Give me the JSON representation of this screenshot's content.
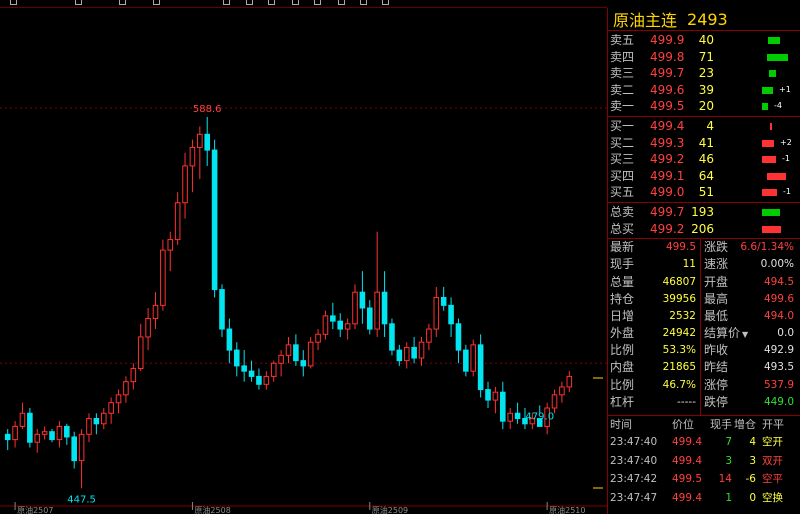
{
  "colors": {
    "up": "#ff3030",
    "down": "#00e5f0",
    "ask_bar": "#00cc00",
    "bid_bar": "#ff3333",
    "grid": "#800000",
    "label_red": "#ff4040"
  },
  "instrument": {
    "name": "原油主连",
    "code": "2493"
  },
  "asks": [
    {
      "label": "卖五",
      "price": "499.9",
      "vol": "40",
      "bar": 0.2,
      "chg": ""
    },
    {
      "label": "卖四",
      "price": "499.8",
      "vol": "71",
      "bar": 0.35,
      "chg": ""
    },
    {
      "label": "卖三",
      "price": "499.7",
      "vol": "23",
      "bar": 0.12,
      "chg": ""
    },
    {
      "label": "卖二",
      "price": "499.6",
      "vol": "39",
      "bar": 0.19,
      "chg": "+1"
    },
    {
      "label": "卖一",
      "price": "499.5",
      "vol": "20",
      "bar": 0.1,
      "chg": "-4"
    }
  ],
  "bids": [
    {
      "label": "买一",
      "price": "499.4",
      "vol": "4",
      "bar": 0.02,
      "chg": ""
    },
    {
      "label": "买二",
      "price": "499.3",
      "vol": "41",
      "bar": 0.2,
      "chg": "+2"
    },
    {
      "label": "买三",
      "price": "499.2",
      "vol": "46",
      "bar": 0.23,
      "chg": "-1"
    },
    {
      "label": "买四",
      "price": "499.1",
      "vol": "64",
      "bar": 0.32,
      "chg": ""
    },
    {
      "label": "买五",
      "price": "499.0",
      "vol": "51",
      "bar": 0.25,
      "chg": "-1"
    }
  ],
  "totals": [
    {
      "label": "总卖",
      "price": "499.7",
      "vol": "193",
      "bar": 0.3,
      "color": "ask"
    },
    {
      "label": "总买",
      "price": "499.2",
      "vol": "206",
      "bar": 0.32,
      "color": "bid"
    }
  ],
  "stats": [
    {
      "l1": "最新",
      "v1": "499.5",
      "c1": "cred",
      "l2": "涨跌",
      "v2": "6.6/1.34%",
      "c2": "cred"
    },
    {
      "l1": "现手",
      "v1": "11",
      "c1": "cyel",
      "l2": "速涨",
      "v2": "0.00%",
      "c2": "cwht"
    },
    {
      "l1": "总量",
      "v1": "46807",
      "c1": "cyel",
      "l2": "开盘",
      "v2": "494.5",
      "c2": "cred"
    },
    {
      "l1": "持仓",
      "v1": "39956",
      "c1": "cyel",
      "l2": "最高",
      "v2": "499.6",
      "c2": "cred"
    },
    {
      "l1": "日增",
      "v1": "2532",
      "c1": "cyel",
      "l2": "最低",
      "v2": "494.0",
      "c2": "cred"
    },
    {
      "l1": "外盘",
      "v1": "24942",
      "c1": "cyel",
      "l2": "结算价",
      "v2": "0.0",
      "c2": "cwht"
    },
    {
      "l1": "比例",
      "v1": "53.3%",
      "c1": "cyel",
      "l2": "昨收",
      "v2": "492.9",
      "c2": "cwht"
    },
    {
      "l1": "内盘",
      "v1": "21865",
      "c1": "cyel",
      "l2": "昨结",
      "v2": "493.5",
      "c2": "cwht"
    },
    {
      "l1": "比例",
      "v1": "46.7%",
      "c1": "cyel",
      "l2": "涨停",
      "v2": "537.9",
      "c2": "cred"
    },
    {
      "l1": "杠杆",
      "v1": "-----",
      "c1": "cwht",
      "l2": "跌停",
      "v2": "449.0",
      "c2": "cgrn"
    }
  ],
  "ticks_header": {
    "time": "时间",
    "price": "价位",
    "hand": "现手",
    "open": "增仓",
    "type": "开平"
  },
  "ticks": [
    {
      "time": "23:47:40",
      "price": "499.4",
      "hand": "7",
      "hc": "cgrn",
      "open": "4",
      "oc": "cyel",
      "type": "空开",
      "tc": "cyel"
    },
    {
      "time": "23:47:40",
      "price": "499.4",
      "hand": "3",
      "hc": "cgrn",
      "open": "3",
      "oc": "cyel",
      "type": "双开",
      "tc": "cred"
    },
    {
      "time": "23:47:42",
      "price": "499.5",
      "hand": "14",
      "hc": "cred",
      "open": "-6",
      "oc": "cyel",
      "type": "空平",
      "tc": "cred"
    },
    {
      "time": "23:47:47",
      "price": "499.4",
      "hand": "1",
      "hc": "cgrn",
      "open": "0",
      "oc": "cyel",
      "type": "空换",
      "tc": "cyel"
    }
  ],
  "chart_data": {
    "type": "candlestick",
    "ylim": [
      440,
      630
    ],
    "ref_lines": [
      592,
      495
    ],
    "x_labels": [
      {
        "i": 1,
        "text": "原油2507"
      },
      {
        "i": 25,
        "text": "原油2508"
      },
      {
        "i": 49,
        "text": "原油2509"
      },
      {
        "i": 73,
        "text": "原油2510"
      }
    ],
    "annotations": [
      {
        "i": 27,
        "price": 588.6,
        "text": "588.6",
        "pos": "above"
      },
      {
        "i": 10,
        "price": 447.5,
        "text": "447.5",
        "pos": "below"
      },
      {
        "i": 72,
        "price": 479.0,
        "text": "479.0",
        "pos": "below"
      }
    ],
    "candles": [
      [
        468,
        470,
        462,
        466
      ],
      [
        466,
        473,
        463,
        471
      ],
      [
        471,
        480,
        470,
        476
      ],
      [
        476,
        478,
        463,
        465
      ],
      [
        465,
        470,
        461,
        468
      ],
      [
        468,
        471,
        466,
        469
      ],
      [
        469,
        470,
        465,
        466
      ],
      [
        466,
        473,
        463,
        471
      ],
      [
        471,
        472,
        464,
        467
      ],
      [
        467,
        469,
        455,
        458
      ],
      [
        458,
        470,
        447.5,
        468
      ],
      [
        468,
        476,
        465,
        474
      ],
      [
        474,
        476,
        468,
        472
      ],
      [
        472,
        478,
        470,
        476
      ],
      [
        476,
        482,
        472,
        480
      ],
      [
        480,
        485,
        476,
        483
      ],
      [
        483,
        490,
        480,
        488
      ],
      [
        488,
        495,
        485,
        493
      ],
      [
        493,
        510,
        492,
        505
      ],
      [
        505,
        516,
        500,
        512
      ],
      [
        512,
        522,
        508,
        517
      ],
      [
        517,
        542,
        515,
        538
      ],
      [
        538,
        545,
        530,
        542
      ],
      [
        542,
        560,
        540,
        556
      ],
      [
        556,
        575,
        550,
        570
      ],
      [
        570,
        580,
        560,
        577
      ],
      [
        577,
        585,
        565,
        582
      ],
      [
        582,
        588.6,
        570,
        576
      ],
      [
        576,
        580,
        520,
        523
      ],
      [
        523,
        525,
        505,
        508
      ],
      [
        508,
        512,
        495,
        500
      ],
      [
        500,
        503,
        490,
        494
      ],
      [
        494,
        500,
        488,
        492
      ],
      [
        492,
        496,
        488,
        490
      ],
      [
        490,
        493,
        485,
        487
      ],
      [
        487,
        492,
        485,
        490
      ],
      [
        490,
        496,
        488,
        495
      ],
      [
        495,
        500,
        490,
        498
      ],
      [
        498,
        505,
        495,
        502
      ],
      [
        502,
        506,
        494,
        496
      ],
      [
        496,
        500,
        490,
        494
      ],
      [
        494,
        505,
        493,
        503
      ],
      [
        503,
        508,
        500,
        506
      ],
      [
        506,
        515,
        504,
        513
      ],
      [
        513,
        518,
        508,
        511
      ],
      [
        511,
        514,
        505,
        508
      ],
      [
        508,
        512,
        504,
        510
      ],
      [
        510,
        525,
        508,
        522
      ],
      [
        522,
        530,
        510,
        516
      ],
      [
        516,
        519,
        506,
        508
      ],
      [
        508,
        545,
        505,
        522
      ],
      [
        522,
        530,
        505,
        510
      ],
      [
        510,
        512,
        498,
        500
      ],
      [
        500,
        502,
        494,
        496
      ],
      [
        496,
        503,
        493,
        501
      ],
      [
        501,
        505,
        495,
        497
      ],
      [
        497,
        505,
        494,
        503
      ],
      [
        503,
        510,
        500,
        508
      ],
      [
        508,
        524,
        505,
        520
      ],
      [
        520,
        524,
        515,
        517
      ],
      [
        517,
        520,
        505,
        510
      ],
      [
        510,
        512,
        495,
        500
      ],
      [
        500,
        502,
        490,
        492
      ],
      [
        492,
        504,
        490,
        502
      ],
      [
        502,
        506,
        482,
        485
      ],
      [
        485,
        488,
        478,
        481
      ],
      [
        481,
        486,
        476,
        484
      ],
      [
        484,
        488,
        470,
        473
      ],
      [
        473,
        478,
        470,
        476
      ],
      [
        476,
        480,
        472,
        474
      ],
      [
        474,
        478,
        470,
        472
      ],
      [
        472,
        476,
        470,
        474
      ],
      [
        474,
        476,
        479,
        471
      ],
      [
        471,
        480,
        468,
        478
      ],
      [
        478,
        485,
        476,
        483
      ],
      [
        483,
        488,
        480,
        486
      ],
      [
        486,
        492,
        484,
        490
      ]
    ]
  }
}
